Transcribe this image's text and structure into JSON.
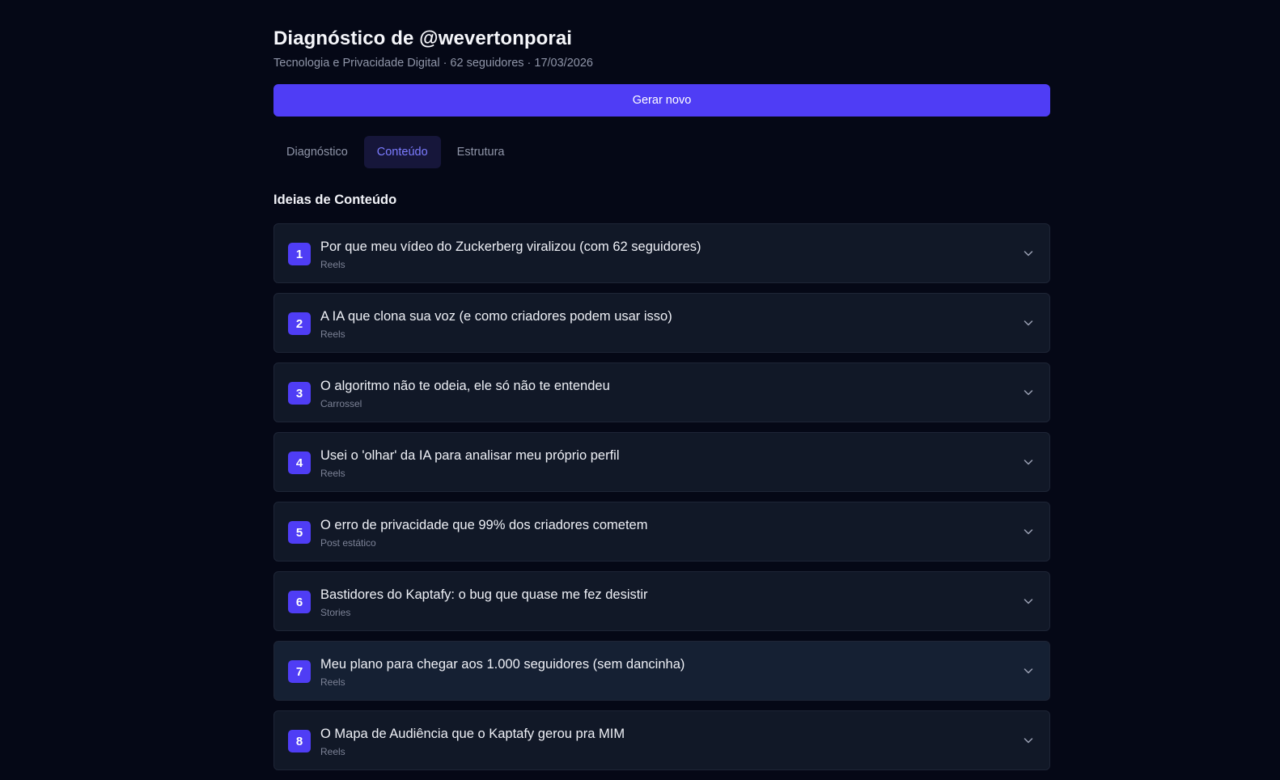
{
  "header": {
    "title": "Diagnóstico de @wevertonporai",
    "subtitle": "Tecnologia e Privacidade Digital · 62 seguidores · 17/03/2026",
    "generate_label": "Gerar novo"
  },
  "tabs": [
    {
      "label": "Diagnóstico"
    },
    {
      "label": "Conteúdo"
    },
    {
      "label": "Estrutura"
    }
  ],
  "section": {
    "title": "Ideias de Conteúdo"
  },
  "ideas": [
    {
      "num": "1",
      "title": "Por que meu vídeo do Zuckerberg viralizou (com 62 seguidores)",
      "type": "Reels"
    },
    {
      "num": "2",
      "title": "A IA que clona sua voz (e como criadores podem usar isso)",
      "type": "Reels"
    },
    {
      "num": "3",
      "title": "O algoritmo não te odeia, ele só não te entendeu",
      "type": "Carrossel"
    },
    {
      "num": "4",
      "title": "Usei o 'olhar' da IA para analisar meu próprio perfil",
      "type": "Reels"
    },
    {
      "num": "5",
      "title": "O erro de privacidade que 99% dos criadores cometem",
      "type": "Post estático"
    },
    {
      "num": "6",
      "title": "Bastidores do Kaptafy: o bug que quase me fez desistir",
      "type": "Stories"
    },
    {
      "num": "7",
      "title": "Meu plano para chegar aos 1.000 seguidores (sem dancinha)",
      "type": "Reels"
    },
    {
      "num": "8",
      "title": "O Mapa de Audiência que o Kaptafy gerou pra MIM",
      "type": "Reels"
    }
  ],
  "icons": {
    "expand": "chevron-down-icon"
  },
  "colors": {
    "accent": "#4f3df5",
    "background": "#050816",
    "card": "#111827",
    "active_tab_text": "#7c7cff"
  }
}
